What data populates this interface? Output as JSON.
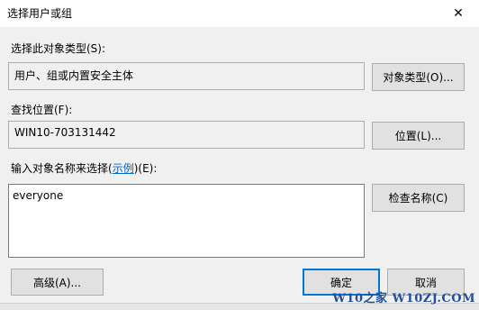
{
  "window": {
    "title": "选择用户或组",
    "close_glyph": "✕"
  },
  "object_type": {
    "label": "选择此对象类型(S):",
    "value": "用户、组或内置安全主体",
    "button": "对象类型(O)..."
  },
  "location": {
    "label": "查找位置(F):",
    "value": "WIN10-703131442",
    "button": "位置(L)..."
  },
  "names": {
    "label_prefix": "输入对象名称来选择(",
    "label_link": "示例",
    "label_suffix": ")(E):",
    "value": "everyone",
    "check_button": "检查名称(C)"
  },
  "footer": {
    "advanced_button": "高级(A)...",
    "ok_button": "确定",
    "cancel_button": "取消"
  },
  "watermark": "W10之家 W10ZJ.COM",
  "colors": {
    "accent": "#0078d7",
    "link": "#0066cc",
    "watermark": "#1f4e9e"
  }
}
